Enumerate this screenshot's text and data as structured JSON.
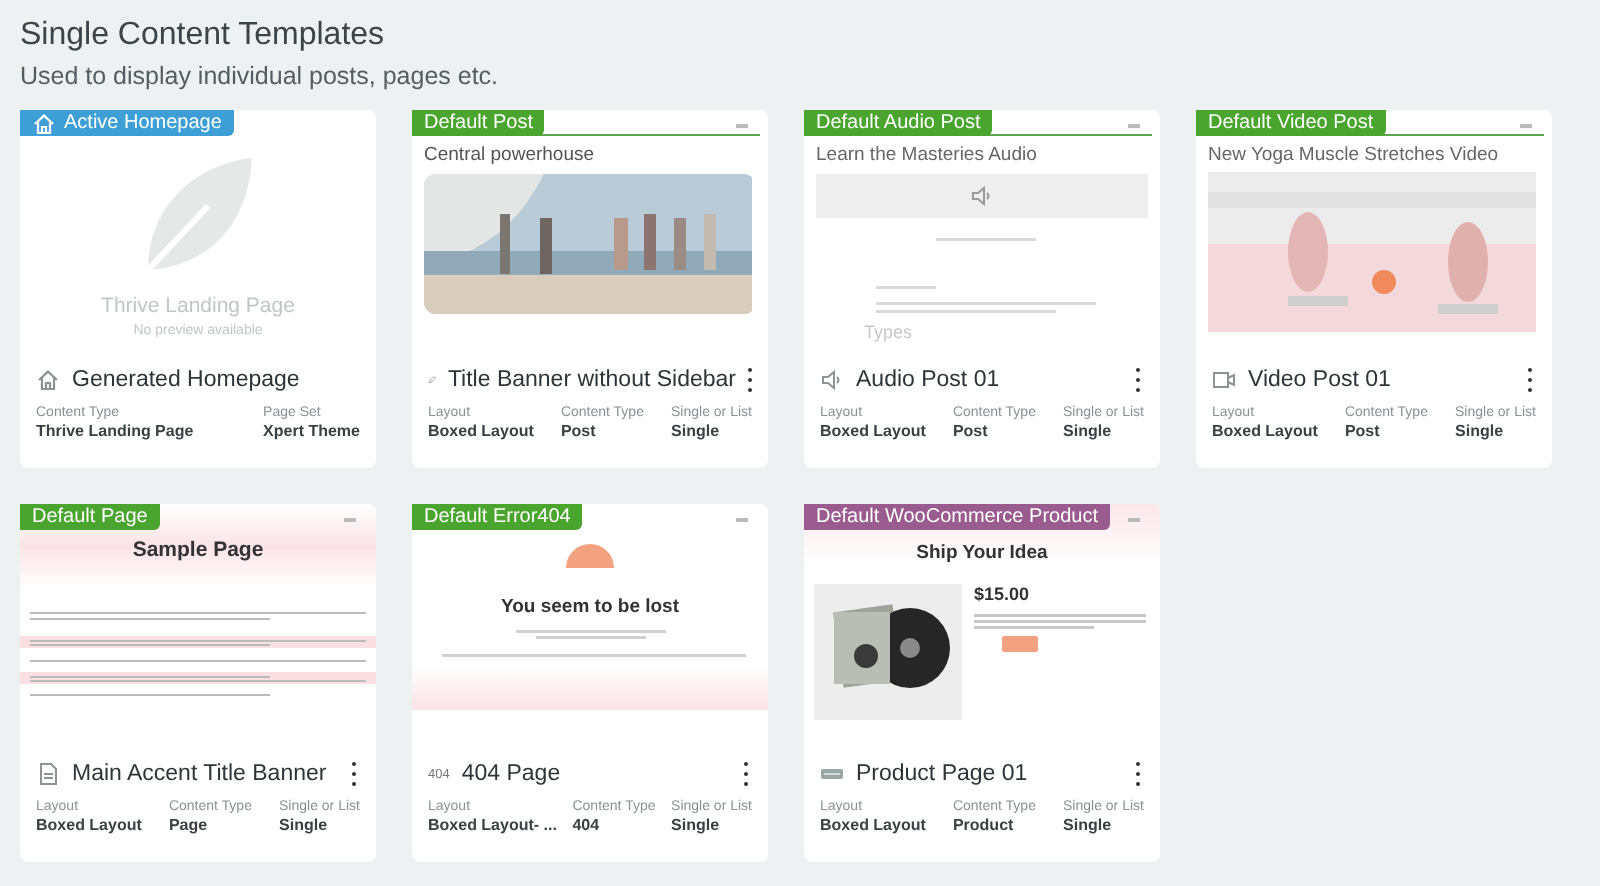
{
  "header": {
    "title": "Single Content Templates",
    "subtitle": "Used to display individual posts, pages etc."
  },
  "cards": [
    {
      "badge": {
        "label": "Active Homepage",
        "color": "#3d9fd6",
        "kind": "active"
      },
      "preview": {
        "kind": "placeholder",
        "heading": "Thrive Landing Page",
        "note": "No preview available"
      },
      "title": "Generated Homepage",
      "has_menu": false,
      "meta": [
        {
          "label": "Content Type",
          "value": "Thrive Landing Page"
        },
        {
          "label": "Page Set",
          "value": "Xpert Theme"
        }
      ]
    },
    {
      "badge": {
        "label": "Default Post",
        "color": "#4aa52e"
      },
      "preview": {
        "kind": "banner-photo",
        "heading": "Central powerhouse"
      },
      "title": "Title Banner without Sidebar",
      "has_menu": true,
      "meta": [
        {
          "label": "Layout",
          "value": "Boxed Layout"
        },
        {
          "label": "Content Type",
          "value": "Post"
        },
        {
          "label": "Single or List",
          "value": "Single"
        }
      ]
    },
    {
      "badge": {
        "label": "Default Audio Post",
        "color": "#4aa52e"
      },
      "preview": {
        "kind": "audio",
        "heading": "Learn the Masteries Audio",
        "note": "Types"
      },
      "title": "Audio Post 01",
      "has_menu": true,
      "meta": [
        {
          "label": "Layout",
          "value": "Boxed Layout"
        },
        {
          "label": "Content Type",
          "value": "Post"
        },
        {
          "label": "Single or List",
          "value": "Single"
        }
      ]
    },
    {
      "badge": {
        "label": "Default Video Post",
        "color": "#4aa52e"
      },
      "preview": {
        "kind": "video",
        "heading": "New Yoga Muscle Stretches Video"
      },
      "title": "Video Post 01",
      "has_menu": true,
      "meta": [
        {
          "label": "Layout",
          "value": "Boxed Layout"
        },
        {
          "label": "Content Type",
          "value": "Post"
        },
        {
          "label": "Single or List",
          "value": "Single"
        }
      ]
    },
    {
      "badge": {
        "label": "Default Page",
        "color": "#4aa52e"
      },
      "preview": {
        "kind": "page",
        "heading": "Sample Page"
      },
      "title": "Main Accent Title Banner",
      "has_menu": true,
      "meta": [
        {
          "label": "Layout",
          "value": "Boxed Layout"
        },
        {
          "label": "Content Type",
          "value": "Page"
        },
        {
          "label": "Single or List",
          "value": "Single"
        }
      ]
    },
    {
      "badge": {
        "label": "Default Error404",
        "color": "#4aa52e"
      },
      "preview": {
        "kind": "error",
        "heading": "You seem to be lost"
      },
      "icon_text": "404",
      "title": "404 Page",
      "has_menu": true,
      "meta": [
        {
          "label": "Layout",
          "value": "Boxed Layout- ..."
        },
        {
          "label": "Content Type",
          "value": "404"
        },
        {
          "label": "Single or List",
          "value": "Single"
        }
      ]
    },
    {
      "badge": {
        "label": "Default WooCommerce Product",
        "color": "#9a5b8e"
      },
      "preview": {
        "kind": "product",
        "heading": "Ship Your Idea",
        "note": "$15.00"
      },
      "title": "Product Page 01",
      "has_menu": true,
      "meta": [
        {
          "label": "Layout",
          "value": "Boxed Layout"
        },
        {
          "label": "Content Type",
          "value": "Product"
        },
        {
          "label": "Single or List",
          "value": "Single"
        }
      ]
    }
  ]
}
